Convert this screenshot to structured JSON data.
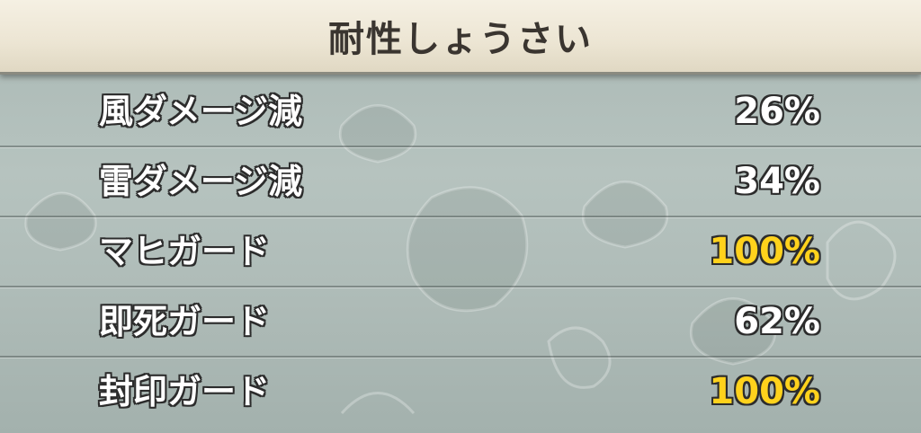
{
  "header": {
    "title": "耐性しょうさい"
  },
  "colors": {
    "normal_value": "#ffffff",
    "max_value": "#ffd21c",
    "outline": "#2c2c2c",
    "header_bg": "#efe8d7"
  },
  "resistances": [
    {
      "label": "風ダメージ減",
      "value": "26%",
      "highlight": false
    },
    {
      "label": "雷ダメージ減",
      "value": "34%",
      "highlight": false
    },
    {
      "label": "マヒガード",
      "value": "100%",
      "highlight": true
    },
    {
      "label": "即死ガード",
      "value": "62%",
      "highlight": false
    },
    {
      "label": "封印ガード",
      "value": "100%",
      "highlight": true
    }
  ]
}
